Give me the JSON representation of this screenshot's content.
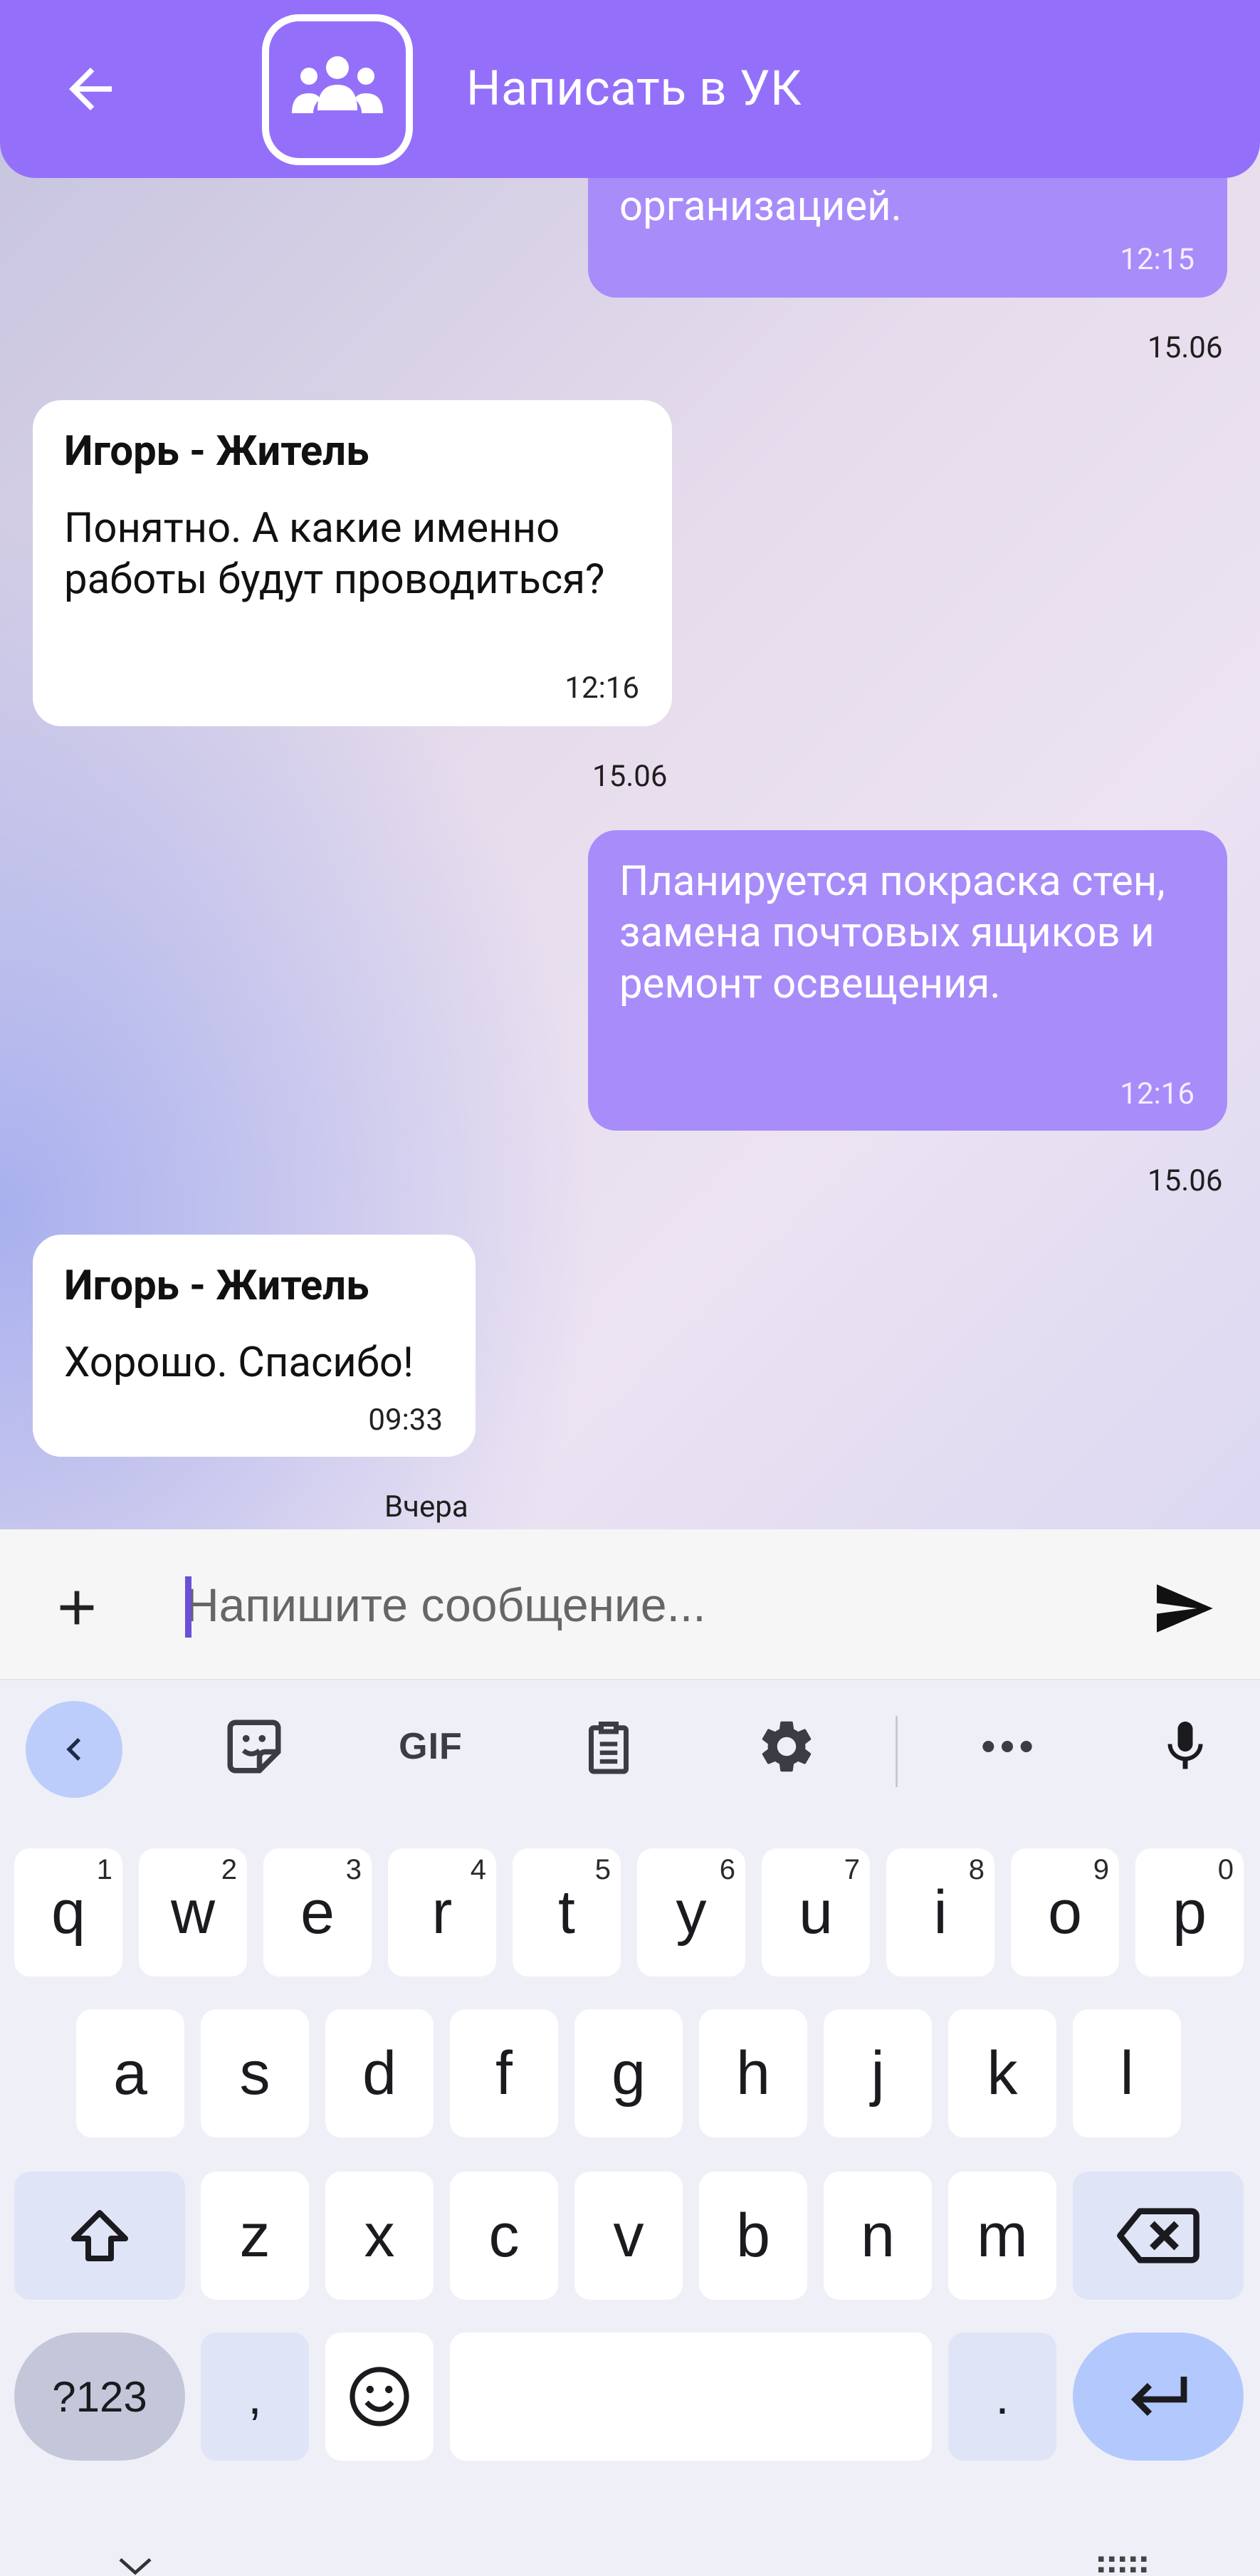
{
  "header": {
    "title": "Написать в УК",
    "back_icon": "arrow-left-icon",
    "avatar_icon": "group-icon"
  },
  "messages": [
    {
      "direction": "out",
      "author": "",
      "text": "организацией.",
      "time": "12:15",
      "date": "15.06"
    },
    {
      "direction": "in",
      "author": "Игорь - Житель",
      "text": "Понятно. А какие именно работы будут проводиться?",
      "time": "12:16",
      "date": "15.06"
    },
    {
      "direction": "out",
      "author": "",
      "text": "Планируется покраска стен, замена почтовых ящиков и ремонт освещения.",
      "time": "12:16",
      "date": "15.06"
    },
    {
      "direction": "in",
      "author": "Игорь - Житель",
      "text": "Хорошо. Спасибо!",
      "time": "09:33",
      "date": "Вчера"
    }
  ],
  "input": {
    "placeholder": "Напишите сообщение...",
    "value": "",
    "attach_icon": "plus-icon",
    "send_icon": "send-icon"
  },
  "keyboard": {
    "toolbar": [
      "chevron-left-icon",
      "sticker-icon",
      "GIF",
      "clipboard-icon",
      "gear-icon",
      "more-icon",
      "mic-icon"
    ],
    "gif_label": "GIF",
    "row1": [
      {
        "key": "q",
        "hint": "1"
      },
      {
        "key": "w",
        "hint": "2"
      },
      {
        "key": "e",
        "hint": "3"
      },
      {
        "key": "r",
        "hint": "4"
      },
      {
        "key": "t",
        "hint": "5"
      },
      {
        "key": "y",
        "hint": "6"
      },
      {
        "key": "u",
        "hint": "7"
      },
      {
        "key": "i",
        "hint": "8"
      },
      {
        "key": "o",
        "hint": "9"
      },
      {
        "key": "p",
        "hint": "0"
      }
    ],
    "row2": [
      "a",
      "s",
      "d",
      "f",
      "g",
      "h",
      "j",
      "k",
      "l"
    ],
    "row3": [
      "z",
      "x",
      "c",
      "v",
      "b",
      "n",
      "m"
    ],
    "symbols_label": "?123",
    "comma_label": ",",
    "period_label": ".",
    "colors": {
      "accent": "#9470fa",
      "bubble_out": "#a88cfa",
      "enter": "#b3c8fc"
    }
  }
}
